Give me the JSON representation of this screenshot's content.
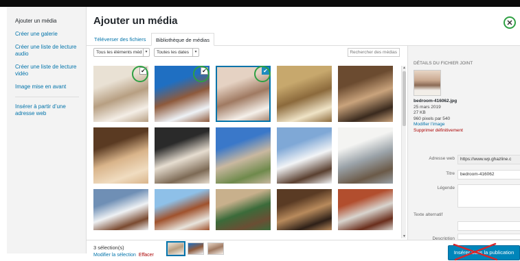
{
  "sidebar": {
    "items": [
      {
        "label": "Ajouter un média",
        "active": true
      },
      {
        "label": "Créer une galerie"
      },
      {
        "label": "Créer une liste de lecture audio"
      },
      {
        "label": "Créer une liste de lecture vidéo"
      },
      {
        "label": "Image mise en avant"
      },
      {
        "label": "Insérer à partir d’une adresse web"
      }
    ]
  },
  "header": {
    "title": "Ajouter un média",
    "close_icon": "close-icon"
  },
  "tabs": [
    {
      "label": "Téléverser des fichiers"
    },
    {
      "label": "Bibliothèque de médias",
      "active": true
    }
  ],
  "filters": {
    "type_select": "Tous les éléments méd",
    "date_select": "Toutes les dates",
    "search_placeholder": "Rechercher des médias"
  },
  "grid": {
    "items": [
      {
        "name": "living-room",
        "selected": true,
        "checked": true,
        "colors": [
          "#e9e1d4",
          "#b79f82",
          "#f4eee6"
        ]
      },
      {
        "name": "snow-cabin",
        "selected": true,
        "checked": true,
        "colors": [
          "#1f6fc2",
          "#8e5a3c",
          "#eef2f6"
        ]
      },
      {
        "name": "bedroom",
        "selected": true,
        "checked": true,
        "active": true,
        "colors": [
          "#e5d2c3",
          "#a07a62",
          "#f5f0ea"
        ]
      },
      {
        "name": "ornate-dome",
        "selected": false,
        "colors": [
          "#c7a86d",
          "#8c6a3c",
          "#efe3c6"
        ]
      },
      {
        "name": "library-room",
        "selected": false,
        "colors": [
          "#6b4b30",
          "#c9a37c",
          "#3a2a1e"
        ]
      },
      {
        "name": "wood-bedroom",
        "selected": false,
        "colors": [
          "#5a3a22",
          "#d9b48a",
          "#f0dcc0"
        ]
      },
      {
        "name": "window-room",
        "selected": false,
        "colors": [
          "#2a2a2a",
          "#e6ddd0",
          "#7d6a55"
        ]
      },
      {
        "name": "castle",
        "selected": false,
        "colors": [
          "#3a78c9",
          "#c9b8a0",
          "#6f8a4c"
        ]
      },
      {
        "name": "mountain-chalet",
        "selected": false,
        "colors": [
          "#7fa8d6",
          "#f2f4f6",
          "#5a4030"
        ]
      },
      {
        "name": "white-kitchen",
        "selected": false,
        "colors": [
          "#f4f4f2",
          "#9aa2a8",
          "#6b5a48"
        ]
      },
      {
        "name": "snowy-house",
        "selected": false,
        "colors": [
          "#6f8fb5",
          "#eef1f4",
          "#7a4a30"
        ]
      },
      {
        "name": "chalet-village",
        "selected": false,
        "colors": [
          "#8ec0e8",
          "#a0522d",
          "#e8e4dc"
        ]
      },
      {
        "name": "billiard-room",
        "selected": false,
        "colors": [
          "#c8b08c",
          "#3b6b3a",
          "#6b4e34"
        ]
      },
      {
        "name": "bookshelves",
        "selected": false,
        "colors": [
          "#5a3b24",
          "#b88a5c",
          "#2e2018"
        ]
      },
      {
        "name": "brick-wall",
        "selected": false,
        "colors": [
          "#b24e2e",
          "#d8d4ce",
          "#6a2e1c"
        ]
      }
    ]
  },
  "details": {
    "title": "Détails du fichier joint",
    "filename": "bedroom-416062.jpg",
    "date": "25 mars 2019",
    "size": "27 KB",
    "dimensions": "960 pixels par 540",
    "edit_link": "Modifier l’image",
    "delete_link": "Supprimer définitivement",
    "fields": {
      "url_label": "Adresse web",
      "url_value": "https://www.wp.ghazline.c",
      "title_label": "Titre",
      "title_value": "bedroom-416062",
      "caption_label": "Légende",
      "alt_label": "Texte alternatif",
      "description_label": "Description"
    }
  },
  "footer": {
    "selection_count": "3 sélection(s)",
    "edit_selection": "Modifier la sélection",
    "clear": "Effacer",
    "insert_button": "Insérer dans la publication"
  },
  "colors": {
    "accent": "#0073aa",
    "button": "#0085ba",
    "annotation": "#2ea043",
    "cross": "#d8262b"
  }
}
